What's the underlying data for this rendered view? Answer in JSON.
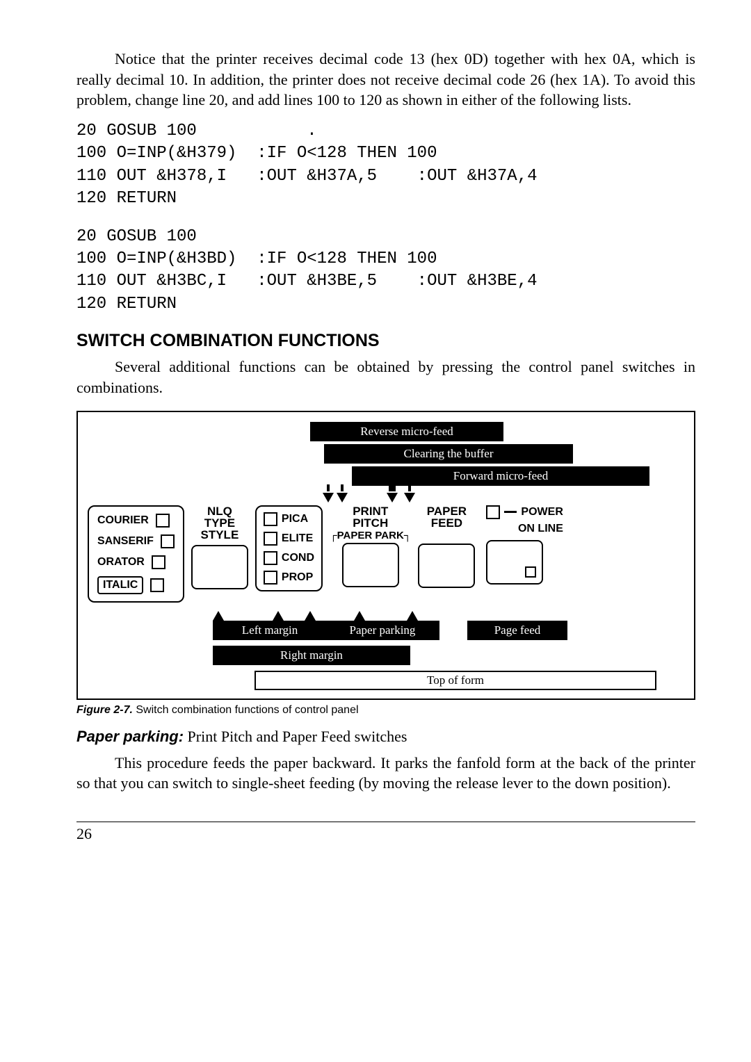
{
  "intro": "Notice that the printer receives decimal code 13 (hex 0D) together with hex 0A, which is really decimal 10. In addition, the printer does not receive decimal code 26 (hex 1A). To avoid this problem, change line 20, and add lines 100 to 120 as shown in either of the following lists.",
  "code1": "20 GOSUB 100           .\n100 O=INP(&H379)  :IF O<128 THEN 100\n110 OUT &H378,I   :OUT &H37A,5    :OUT &H37A,4\n120 RETURN",
  "code2": "20 GOSUB 100\n100 O=INP(&H3BD)  :IF O<128 THEN 100\n110 OUT &H3BC,I   :OUT &H3BE,5    :OUT &H3BE,4\n120 RETURN",
  "section_heading": "SWITCH COMBINATION FUNCTIONS",
  "section_para": "Several additional functions can be obtained by pressing the control panel switches in combinations.",
  "figure": {
    "bar_reverse": "Reverse micro-feed",
    "bar_clear": "Clearing the buffer",
    "bar_forward": "Forward micro-feed",
    "fonts": {
      "courier": "COURIER",
      "sanserif": "SANSERIF",
      "orator": "ORATOR",
      "italic": "ITALIC"
    },
    "nlq": {
      "l1": "NLQ",
      "l2": "TYPE",
      "l3": "STYLE"
    },
    "pitch": {
      "pica": "PICA",
      "elite": "ELITE",
      "cond": "COND",
      "prop": "PROP"
    },
    "printpitch": {
      "l1": "PRINT",
      "l2": "PITCH"
    },
    "paperfeed": {
      "l1": "PAPER",
      "l2": "FEED"
    },
    "power": "POWER",
    "online": "ON LINE",
    "paperpark": "PAPER PARK",
    "left_margin": "Left margin",
    "paper_parking": "Paper parking",
    "page_feed": "Page feed",
    "right_margin": "Right margin",
    "top_of_form": "Top of form"
  },
  "caption_bold": "Figure 2-7.",
  "caption_rest": " Switch combination functions of control panel",
  "subhead_bold": "Paper parking:",
  "subhead_rest": " Print Pitch and Paper Feed switches",
  "body2": "This procedure feeds the paper backward. It parks the fanfold form at the back of the printer so that you can switch to single-sheet feeding (by moving the release lever to the down position).",
  "page_number": "26"
}
